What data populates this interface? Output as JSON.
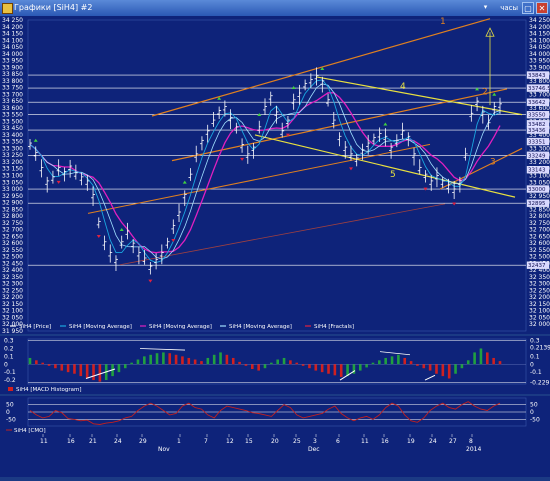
{
  "window": {
    "title": "Графики [SiH4] #2",
    "hours_label": "часы",
    "close_glyph": "✕",
    "restore_glyph": "▢",
    "dropdown_glyph": "▾"
  },
  "colors": {
    "background": "#0e237a",
    "price": "#ffffff",
    "ma_fast": "#1aa7e0",
    "ma_magenta": "#e020c0",
    "ma_light": "#a0e0ff",
    "fractal_up": "#40d040",
    "fractal_down": "#e02040",
    "trend_orange": "#e08020",
    "trend_yellow": "#e8e040",
    "macd_up": "#20a040",
    "macd_down": "#d02020",
    "cmo": "#c02020"
  },
  "price_axis": {
    "min": 31950,
    "max": 34250,
    "ticks": [
      "34 250",
      "34 200",
      "34 150",
      "34 100",
      "34 050",
      "34 000",
      "33 950",
      "33 900",
      "33 850",
      "33 800",
      "33 750",
      "33 700",
      "33 650",
      "33 600",
      "33 550",
      "33 500",
      "33 450",
      "33 400",
      "33 350",
      "33 300",
      "33 250",
      "33 200",
      "33 150",
      "33 100",
      "33 050",
      "33 000",
      "32 950",
      "32 900",
      "32 850",
      "32 800",
      "32 750",
      "32 700",
      "32 650",
      "32 600",
      "32 550",
      "32 500",
      "32 450",
      "32 400",
      "32 350",
      "32 300",
      "32 250",
      "32 200",
      "32 150",
      "32 100",
      "32 050",
      "32 000",
      "31 950"
    ],
    "right_ticks": [
      "34 250",
      "34 200",
      "34 150",
      "34 100",
      "34 050",
      "34 000",
      "33 950",
      "33 900",
      "33 850",
      "33 800",
      "33 750",
      "33 700",
      "33 650",
      "33 600",
      "33 550",
      "33 500",
      "33 450",
      "33 400",
      "33 350",
      "33 300",
      "33 250",
      "33 200",
      "33 150",
      "33 100",
      "33 050",
      "33 000",
      "32 950",
      "32 900",
      "32 850",
      "32 800",
      "32 750",
      "32 700",
      "32 650",
      "32 600",
      "32 550",
      "32 500",
      "32 450",
      "32 400",
      "32 350",
      "32 300",
      "32 250",
      "32 200",
      "32 150",
      "32 100",
      "32 050",
      "32 000"
    ]
  },
  "price_labels": [
    {
      "text": "33843",
      "value": 33843
    },
    {
      "text": "33746.5",
      "value": 33746.5
    },
    {
      "text": "33642",
      "value": 33642
    },
    {
      "text": "33550",
      "value": 33550
    },
    {
      "text": "33482",
      "value": 33482
    },
    {
      "text": "33436",
      "value": 33436
    },
    {
      "text": "33351",
      "value": 33351
    },
    {
      "text": "33249",
      "value": 33249
    },
    {
      "text": "33143",
      "value": 33143
    },
    {
      "text": "33000",
      "value": 33000
    },
    {
      "text": "32895",
      "value": 32895
    },
    {
      "text": "32437",
      "value": 32437
    }
  ],
  "horizontal_levels": [
    33843,
    33746.5,
    33642,
    33550,
    33436,
    33249,
    33000,
    32895,
    32437
  ],
  "wave_labels": [
    {
      "text": "1",
      "color": "#e08020"
    },
    {
      "text": "2",
      "color": "#e08020"
    },
    {
      "text": "3",
      "color": "#e08020"
    },
    {
      "text": "4",
      "color": "#e8e040"
    },
    {
      "text": "5",
      "color": "#e8e040"
    }
  ],
  "price_series": [
    33330,
    33260,
    33150,
    33050,
    33080,
    33150,
    33120,
    33160,
    33110,
    33080,
    33050,
    32950,
    32750,
    32600,
    32520,
    32470,
    32600,
    32680,
    32590,
    32520,
    32480,
    32420,
    32470,
    32520,
    32600,
    32720,
    32820,
    32950,
    33100,
    33250,
    33350,
    33420,
    33500,
    33570,
    33600,
    33520,
    33450,
    33320,
    33250,
    33300,
    33450,
    33600,
    33680,
    33560,
    33420,
    33500,
    33650,
    33700,
    33770,
    33800,
    33830,
    33790,
    33650,
    33500,
    33380,
    33300,
    33250,
    33220,
    33280,
    33330,
    33370,
    33400,
    33380,
    33300,
    33350,
    33420,
    33380,
    33250,
    33150,
    33100,
    33050,
    33090,
    33050,
    33020,
    32990,
    33050,
    33250,
    33550,
    33640,
    33560,
    33480,
    33600,
    33620
  ],
  "fractal_ups": [
    1,
    16,
    27,
    33,
    40,
    46,
    51,
    62,
    78,
    81
  ],
  "fractal_downs": [
    5,
    12,
    21,
    25,
    37,
    45,
    56,
    69,
    74
  ],
  "legend": [
    {
      "text": "SiH4 [Price]",
      "color": "#ffffff"
    },
    {
      "text": "SiH4 [Moving Average]",
      "color": "#1aa7e0"
    },
    {
      "text": "SiH4 [Moving Average]",
      "color": "#e020c0"
    },
    {
      "text": "SiH4 [Moving Average]",
      "color": "#a0e0ff"
    },
    {
      "text": "SiH4 [Fractals]",
      "color": "#e02040"
    }
  ],
  "macd": {
    "ticks": [
      "0.3",
      "0.2",
      "0.1",
      "0",
      "-0.1",
      "-0.2"
    ],
    "right_labels": [
      "0.3",
      "0.2139",
      "0.1",
      "0",
      "-0.1",
      "-0.2291"
    ],
    "min": -0.25,
    "max": 0.32,
    "values": [
      0.08,
      0.05,
      0.02,
      -0.02,
      -0.05,
      -0.08,
      -0.1,
      -0.12,
      -0.15,
      -0.18,
      -0.2,
      -0.22,
      -0.2,
      -0.15,
      -0.1,
      -0.05,
      0.02,
      0.06,
      0.1,
      0.12,
      0.14,
      0.15,
      0.14,
      0.12,
      0.1,
      0.08,
      0.06,
      0.04,
      0.08,
      0.12,
      0.15,
      0.12,
      0.08,
      0.03,
      -0.02,
      -0.06,
      -0.08,
      -0.05,
      0.02,
      0.06,
      0.08,
      0.05,
      0.02,
      -0.02,
      -0.05,
      -0.08,
      -0.1,
      -0.12,
      -0.14,
      -0.16,
      -0.15,
      -0.12,
      -0.08,
      -0.04,
      0.02,
      0.05,
      0.08,
      0.1,
      0.12,
      0.08,
      0.04,
      -0.02,
      -0.05,
      -0.08,
      -0.12,
      -0.15,
      -0.18,
      -0.12,
      -0.05,
      0.05,
      0.15,
      0.2,
      0.15,
      0.08,
      0.04
    ],
    "legend": "SiH4 [MACD Histogram]"
  },
  "cmo": {
    "ticks": [
      "50",
      "0",
      "-50"
    ],
    "min": -95,
    "max": 95,
    "values": [
      10,
      -20,
      -40,
      -30,
      10,
      -5,
      -45,
      -50,
      -60,
      -55,
      -80,
      -85,
      -75,
      -70,
      -60,
      -40,
      -30,
      10,
      40,
      60,
      40,
      10,
      -20,
      -10,
      40,
      60,
      30,
      20,
      -20,
      -40,
      10,
      40,
      30,
      20,
      10,
      -5,
      -10,
      -20,
      -30,
      10,
      50,
      30,
      -20,
      -40,
      -30,
      -20,
      -10,
      20,
      40,
      -10,
      -40,
      -60,
      -40,
      -30,
      -50,
      -20,
      30,
      60,
      40,
      -20,
      -60,
      -70,
      -40,
      10,
      40,
      60,
      30,
      20,
      50,
      70,
      40,
      20,
      10,
      40,
      60
    ],
    "legend": "SiH4 [CMO]"
  },
  "date_axis": {
    "labels": [
      "11",
      "16",
      "21",
      "24",
      "29",
      "1",
      "7",
      "12",
      "15",
      "20",
      "25",
      "3",
      "6",
      "11",
      "16",
      "19",
      "24",
      "27",
      "8"
    ],
    "months": [
      "Nov",
      "Dec",
      "2014"
    ]
  }
}
